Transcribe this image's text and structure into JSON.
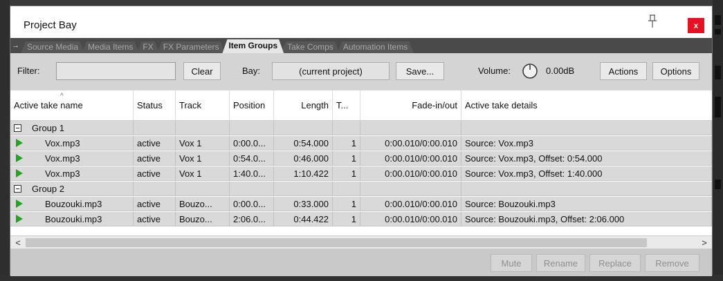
{
  "window": {
    "title": "Project Bay",
    "close_label": "x"
  },
  "tabs": [
    {
      "label": "Source Media",
      "active": false
    },
    {
      "label": "Media Items",
      "active": false
    },
    {
      "label": "FX",
      "active": false
    },
    {
      "label": "FX Parameters",
      "active": false
    },
    {
      "label": "Item Groups",
      "active": true
    },
    {
      "label": "Take Comps",
      "active": false
    },
    {
      "label": "Automation Items",
      "active": false
    }
  ],
  "toolbar": {
    "filter_label": "Filter:",
    "filter_value": "",
    "clear_label": "Clear",
    "bay_label": "Bay:",
    "bay_value": "(current project)",
    "save_label": "Save...",
    "volume_label": "Volume:",
    "volume_value": "0.00dB",
    "actions_label": "Actions",
    "options_label": "Options"
  },
  "table": {
    "columns": [
      "Active take name",
      "Status",
      "Track",
      "Position",
      "Length",
      "T...",
      "Fade-in/out",
      "Active take details"
    ],
    "rows": [
      {
        "type": "group",
        "name": "Group 1"
      },
      {
        "type": "item",
        "name": "Vox.mp3",
        "status": "active",
        "track": "Vox 1",
        "position": "0:00.0...",
        "length": "0:54.000",
        "takes": "1",
        "fade": "0:00.010/0:00.010",
        "details": "Source: Vox.mp3"
      },
      {
        "type": "item",
        "name": "Vox.mp3",
        "status": "active",
        "track": "Vox 1",
        "position": "0:54.0...",
        "length": "0:46.000",
        "takes": "1",
        "fade": "0:00.010/0:00.010",
        "details": "Source: Vox.mp3, Offset: 0:54.000"
      },
      {
        "type": "item",
        "name": "Vox.mp3",
        "status": "active",
        "track": "Vox 1",
        "position": "1:40.0...",
        "length": "1:10.422",
        "takes": "1",
        "fade": "0:00.010/0:00.010",
        "details": "Source: Vox.mp3, Offset: 1:40.000"
      },
      {
        "type": "group",
        "name": "Group 2"
      },
      {
        "type": "item",
        "name": "Bouzouki.mp3",
        "status": "active",
        "track": "Bouzo...",
        "position": "0:00.0...",
        "length": "0:33.000",
        "takes": "1",
        "fade": "0:00.010/0:00.010",
        "details": "Source: Bouzouki.mp3"
      },
      {
        "type": "item",
        "name": "Bouzouki.mp3",
        "status": "active",
        "track": "Bouzo...",
        "position": "2:06.0...",
        "length": "0:44.422",
        "takes": "1",
        "fade": "0:00.010/0:00.010",
        "details": "Source: Bouzouki.mp3, Offset: 2:06.000"
      }
    ]
  },
  "bottom_buttons": [
    "Mute",
    "Rename",
    "Replace",
    "Remove"
  ],
  "scroll": {
    "left_arrow": "<",
    "right_arrow": ">"
  },
  "colors": {
    "close": "#e81123",
    "play": "#1fa51f",
    "panel": "#d4d4d4",
    "tabs_bg": "#4a4a4a"
  }
}
